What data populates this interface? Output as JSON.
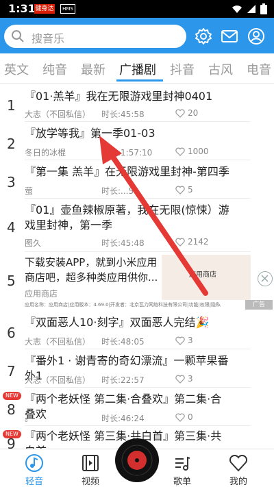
{
  "status_bar": {
    "time": "1:31",
    "notif1": "健身达",
    "notif2": "HMS"
  },
  "header": {
    "search_placeholder": "搜音乐",
    "icons": [
      "gear-icon",
      "mail-icon",
      "user-icon"
    ],
    "accent": "#2b96ea"
  },
  "tabs": {
    "items": [
      "英文",
      "纯音",
      "最新",
      "广播剧",
      "抖音",
      "古风",
      "电音"
    ],
    "active": "广播剧"
  },
  "list": {
    "rows": [
      {
        "num": "1",
        "title": "『01·羔羊』我在无限游戏里封神0401",
        "author": "大志（不回私信）",
        "duration": "时长:45:58",
        "likes": "20"
      },
      {
        "num": "2",
        "title": "『放学等我』第一季01-03",
        "author": "冬日的冰棍",
        "duration": "时长:1:57:10",
        "likes": "1000"
      },
      {
        "num": "3",
        "title": "『第一集  羔羊』在无限游戏里封神-第四季",
        "author": "萤",
        "duration": "时长:...59",
        "likes": "5"
      },
      {
        "num": "4",
        "title": "『01』壶鱼辣椒原著，我在无限(惊悚）游戏里封神，第一季",
        "author": "图久",
        "duration": "时长:45:48",
        "likes": "2142"
      },
      {
        "num": "6",
        "title": "『双面恶人10·刻字』双面恶人完结🎉",
        "author": "大志（不回私信）",
        "duration": "时长:48:05",
        "likes": "3"
      },
      {
        "num": "7",
        "title": "『番外1 · 谢青寄的奇幻漂流』一颗苹果番外1",
        "author": "大志（不回私信）",
        "duration": "时长:22:57",
        "likes": "3"
      },
      {
        "num": "8",
        "title": "『两个老妖怪 第二集·合叠欢』第二集·合叠欢",
        "author": "。",
        "duration": "时长:46:24",
        "likes": "0",
        "badge": "NEW"
      },
      {
        "num": "9",
        "title": "『两个老妖怪 第三集·共白首』第三集·共白首",
        "author": "",
        "duration": "",
        "likes": "",
        "badge": "NEW"
      }
    ],
    "ad": {
      "num": "5",
      "title": "下载安装APP，就到小米应用商店吧，超多种类应用供你...",
      "source": "应用商店",
      "fine_print": "应用名称：应用商店|应用版本：4.69.0|开发者：北京瓦力网络科技有限公司|功能|权限|隐私",
      "label": "广告",
      "image_text": "应用商店"
    }
  },
  "bottom_nav": {
    "items": [
      {
        "label": "轻音",
        "icon": "music-note-icon",
        "active": true
      },
      {
        "label": "视频",
        "icon": "film-icon",
        "active": false
      },
      {
        "label": "歌单",
        "icon": "playlist-icon",
        "active": false
      },
      {
        "label": "我的",
        "icon": "heart-icon",
        "active": false
      }
    ]
  },
  "colors": {
    "accent": "#2b96ea",
    "arrow": "#e53935",
    "record": "#d32f2f"
  }
}
